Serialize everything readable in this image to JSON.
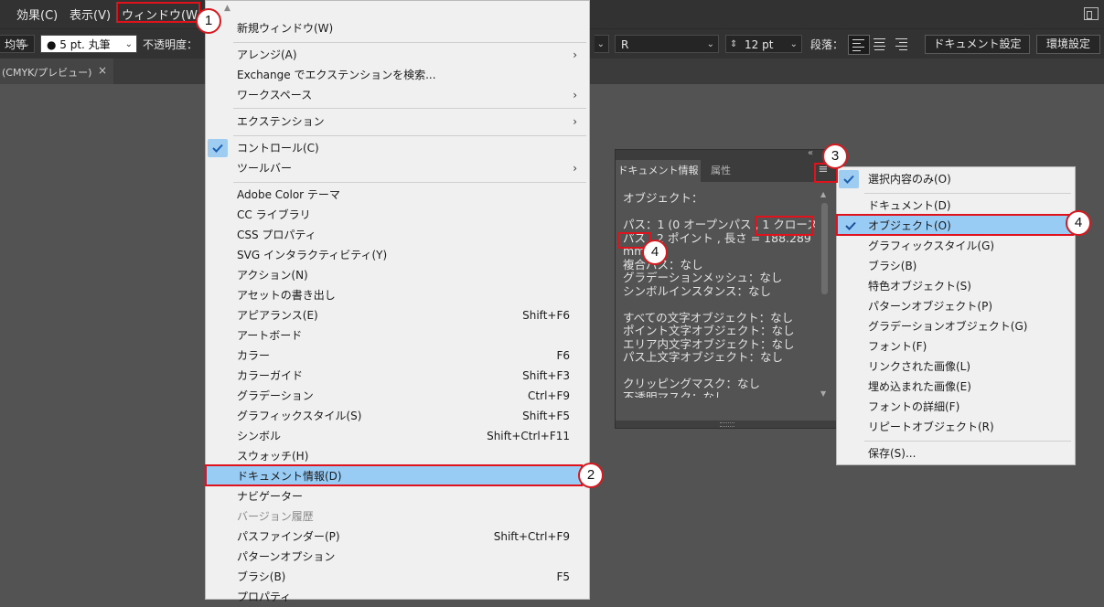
{
  "menubar": {
    "items": [
      "効果(C)",
      "表示(V)",
      "ウィンドウ(W)"
    ]
  },
  "controlbar": {
    "stroke_profile": "均等",
    "brush": "● 5 pt. 丸筆",
    "opacity_label": "不透明度：",
    "font_style": "R",
    "font_size": "12 pt",
    "paragraph_label": "段落：",
    "doc_settings_button": "ドキュメント設定",
    "preferences_button": "環境設定"
  },
  "doc_tab": {
    "label": "(CMYK/プレビュー)",
    "close": "×"
  },
  "window_menu": {
    "items": [
      {
        "label": "新規ウィンドウ(W)"
      },
      {
        "label": "アレンジ(A)",
        "submenu": true
      },
      {
        "label": "Exchange でエクステンションを検索..."
      },
      {
        "label": "ワークスペース",
        "submenu": true
      },
      {
        "label": "エクステンション",
        "submenu": true
      },
      {
        "label": "コントロール(C)",
        "checked": true
      },
      {
        "label": "ツールバー",
        "submenu": true
      },
      {
        "label": "Adobe Color テーマ"
      },
      {
        "label": "CC ライブラリ"
      },
      {
        "label": "CSS プロパティ"
      },
      {
        "label": "SVG インタラクティビティ(Y)"
      },
      {
        "label": "アクション(N)"
      },
      {
        "label": "アセットの書き出し"
      },
      {
        "label": "アピアランス(E)",
        "shortcut": "Shift+F6"
      },
      {
        "label": "アートボード"
      },
      {
        "label": "カラー",
        "shortcut": "F6"
      },
      {
        "label": "カラーガイド",
        "shortcut": "Shift+F3"
      },
      {
        "label": "グラデーション",
        "shortcut": "Ctrl+F9"
      },
      {
        "label": "グラフィックスタイル(S)",
        "shortcut": "Shift+F5"
      },
      {
        "label": "シンボル",
        "shortcut": "Shift+Ctrl+F11"
      },
      {
        "label": "スウォッチ(H)"
      },
      {
        "label": "ドキュメント情報(D)",
        "highlighted": true
      },
      {
        "label": "ナビゲーター"
      },
      {
        "label": "バージョン履歴",
        "disabled": true
      },
      {
        "label": "パスファインダー(P)",
        "shortcut": "Shift+Ctrl+F9"
      },
      {
        "label": "パターンオプション"
      },
      {
        "label": "ブラシ(B)",
        "shortcut": "F5"
      },
      {
        "label": "プロパティ"
      }
    ]
  },
  "doc_info_panel": {
    "tab_active": "ドキュメント情報",
    "tab_other": "属性",
    "panel_menu_icon": "≡",
    "collapse_icon": "«",
    "content": "オブジェクト：\n\nパス：1 (0 オープンパス , 1 クローズ\nパス , 2 ポイント , 長さ = 188.289\nmm\n複合パス：なし\nグラデーションメッシュ：なし\nシンボルインスタンス：なし\n\nすべての文字オブジェクト：なし\nポイント文字オブジェクト：なし\nエリア内文字オブジェクト：なし\nパス上文字オブジェクト：なし\n\nクリッピングマスク：なし\n不透明マスク：なし"
  },
  "flyout_menu": {
    "items": [
      {
        "label": "選択内容のみ(O)",
        "checked": true
      },
      {
        "label": "ドキュメント(D)"
      },
      {
        "label": "オブジェクト(O)",
        "checked": true,
        "highlighted": true
      },
      {
        "label": "グラフィックスタイル(G)"
      },
      {
        "label": "ブラシ(B)"
      },
      {
        "label": "特色オブジェクト(S)"
      },
      {
        "label": "パターンオブジェクト(P)"
      },
      {
        "label": "グラデーションオブジェクト(G)"
      },
      {
        "label": "フォント(F)"
      },
      {
        "label": "リンクされた画像(L)"
      },
      {
        "label": "埋め込まれた画像(E)"
      },
      {
        "label": "フォントの詳細(F)"
      },
      {
        "label": "リピートオブジェクト(R)"
      },
      {
        "label": "保存(S)..."
      }
    ]
  },
  "callouts": {
    "step1": "1",
    "step2": "2",
    "step3": "3",
    "step4a": "4",
    "step4b": "4"
  },
  "colors": {
    "app_dark": "#323232",
    "canvas": "#535353",
    "menu_bg": "#f0f0f0",
    "highlight": "#99ccf5",
    "callout_red": "#e0121b"
  }
}
